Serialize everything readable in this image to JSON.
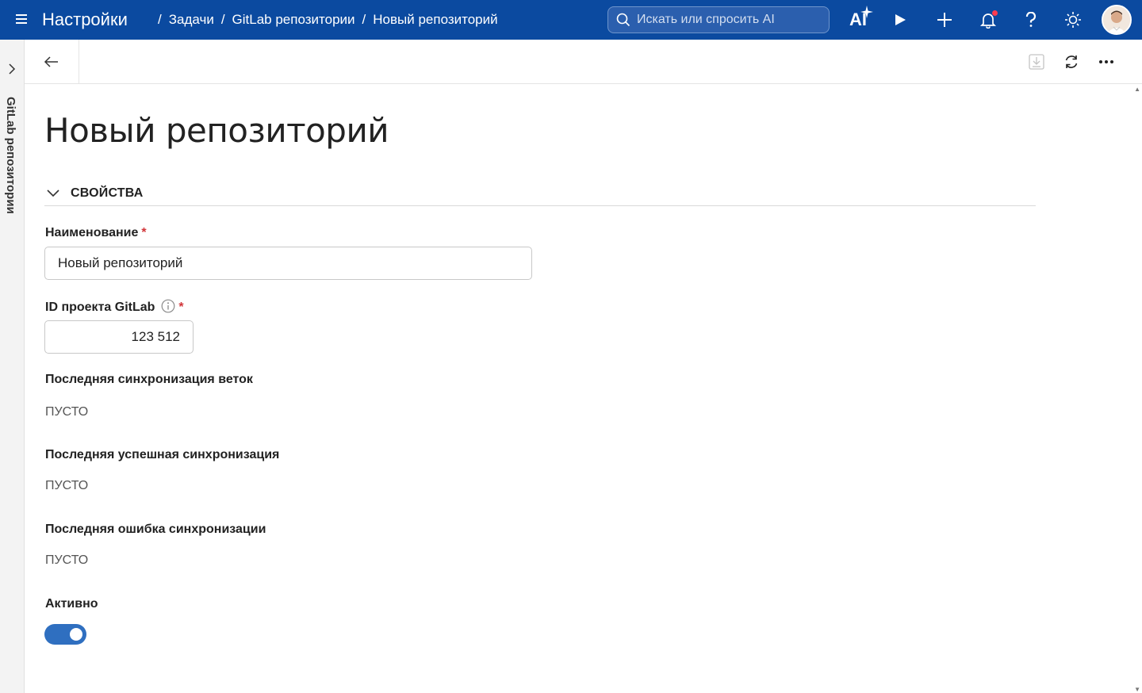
{
  "header": {
    "app_title": "Настройки",
    "breadcrumb": [
      "Задачи",
      "GitLab репозитории",
      "Новый репозиторий"
    ],
    "search_placeholder": "Искать или спросить AI",
    "ai_label": "AI",
    "accent_color": "#0b4aa0"
  },
  "siderail": {
    "label": "GitLab репозитории"
  },
  "page": {
    "title": "Новый репозиторий",
    "section_title": "СВОЙСТВА"
  },
  "fields": {
    "name": {
      "label": "Наименование",
      "value": "Новый репозиторий",
      "required_mark": "*"
    },
    "project_id": {
      "label": "ID проекта GitLab",
      "value": "123 512",
      "required_mark": "*"
    },
    "last_branch_sync": {
      "label": "Последняя синхронизация веток",
      "value": "ПУСТО"
    },
    "last_success_sync": {
      "label": "Последняя успешная синхронизация",
      "value": "ПУСТО"
    },
    "last_sync_error": {
      "label": "Последняя ошибка синхронизации",
      "value": "ПУСТО"
    },
    "active": {
      "label": "Активно",
      "checked": true
    }
  }
}
